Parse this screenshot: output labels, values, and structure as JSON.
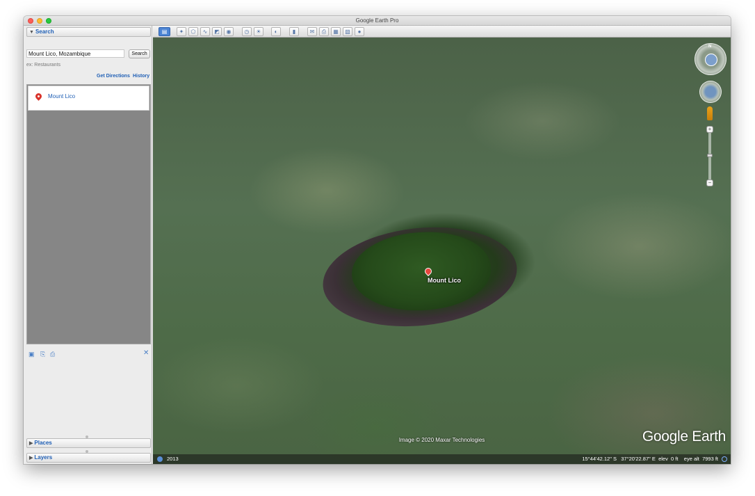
{
  "window": {
    "title": "Google Earth Pro"
  },
  "search": {
    "header": "Search",
    "query": "Mount Lico, Mozambique",
    "button_label": "Search",
    "hint": "ex: Restaurants",
    "get_directions": "Get Directions",
    "history": "History",
    "result": "Mount Lico"
  },
  "panels": {
    "places": "Places",
    "layers": "Layers"
  },
  "map": {
    "place_label": "Mount Lico",
    "attribution": "Image © 2020 Maxar Technologies",
    "brand": "Google Earth",
    "compass_north": "N"
  },
  "status": {
    "year": "2013",
    "latitude": "15°44'42.12\" S",
    "longitude": "37°20'22.87\" E",
    "elev_label": "elev",
    "elev_value": "0 ft",
    "eye_alt_label": "eye alt",
    "eye_alt_value": "7993 ft"
  },
  "toolbar_icons": [
    "sidebar-toggle-icon",
    "placemark-icon",
    "polygon-icon",
    "path-icon",
    "image-overlay-icon",
    "tour-icon",
    "historical-imagery-icon",
    "sun-icon",
    "planets-icon",
    "ruler-icon",
    "email-icon",
    "print-icon",
    "save-image-icon",
    "maps-icon",
    "earth-icon"
  ]
}
